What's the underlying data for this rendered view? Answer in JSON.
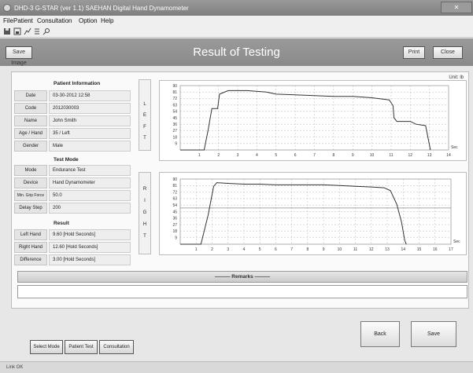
{
  "window": {
    "title": "DHD-3 G-STAR (ver 1.1) SAEHAN Digital Hand Dynamometer",
    "close_label": "✕"
  },
  "menu": [
    "File",
    "Patient",
    "Consultation",
    "Option",
    "Help"
  ],
  "toolbar": {
    "icons": [
      "disk-icon",
      "save-icon",
      "chart-icon",
      "list-icon",
      "search-icon"
    ]
  },
  "header": {
    "title": "Result of Testing",
    "save_image": "Save Image",
    "print": "Print",
    "close": "Close"
  },
  "unit": "Unit: lb",
  "patient": {
    "section": "Patient Information",
    "rows": [
      {
        "label": "Date",
        "value": "03-30-2012 12:58"
      },
      {
        "label": "Code",
        "value": "2012030003"
      },
      {
        "label": "Name",
        "value": "John Smith"
      },
      {
        "label": "Age / Hand",
        "value": "35 / Left"
      },
      {
        "label": "Gender",
        "value": "Male"
      }
    ]
  },
  "test_mode": {
    "section": "Test Mode",
    "rows": [
      {
        "label": "Mode",
        "value": "Endurance Test"
      },
      {
        "label": "Device",
        "value": "Hand Dynamometer"
      },
      {
        "label": "Min. Grip Force",
        "value": "50.0"
      },
      {
        "label": "Delay Step",
        "value": "200"
      }
    ]
  },
  "result": {
    "section": "Result",
    "rows": [
      {
        "label": "Left Hand",
        "value": "9.60 [Hold Seconds]"
      },
      {
        "label": "Right Hand",
        "value": "12.60 [Hold Seconds]"
      },
      {
        "label": "Difference",
        "value": "3.00 [Hold Seconds]"
      }
    ]
  },
  "side_labels": {
    "left": [
      "L",
      "E",
      "F",
      "T"
    ],
    "right": [
      "R",
      "I",
      "G",
      "H",
      "T"
    ]
  },
  "chart_data": [
    {
      "type": "line",
      "series": [
        {
          "name": "LEFT",
          "x": [
            0,
            1.25,
            1.45,
            1.65,
            1.95,
            2.05,
            2.5,
            3.5,
            4.5,
            5,
            6,
            7,
            8,
            9,
            10,
            10.9,
            11.1,
            11.15,
            11.3,
            12,
            12.3,
            12.8,
            13.05
          ],
          "y": [
            0,
            0,
            27,
            58,
            58,
            78,
            83,
            83,
            81,
            78,
            77,
            76,
            75,
            75,
            73,
            70,
            62,
            45,
            40,
            40,
            36,
            34,
            0
          ]
        }
      ],
      "xlabel": "Sec",
      "ylabel": "",
      "xlim": [
        0,
        14
      ],
      "ylim": [
        0,
        90
      ],
      "x_ticks": [
        1,
        2,
        3,
        4,
        5,
        6,
        7,
        8,
        9,
        10,
        11,
        12,
        13,
        14
      ],
      "y_ticks": [
        9,
        18,
        27,
        36,
        45,
        54,
        63,
        72,
        81,
        90
      ],
      "grid": true
    },
    {
      "type": "line",
      "series": [
        {
          "name": "RIGHT",
          "x": [
            0,
            1.3,
            1.5,
            1.75,
            2.1,
            2.3,
            3,
            4,
            5,
            6,
            7,
            8,
            9,
            10,
            11,
            12,
            12.8,
            13.2,
            13.6,
            13.9,
            14.1,
            14.2
          ],
          "y": [
            0,
            0,
            18,
            40,
            80,
            85,
            84,
            83,
            83,
            82,
            82,
            82,
            82,
            81,
            80,
            79,
            78,
            74,
            55,
            30,
            5,
            0
          ]
        }
      ],
      "xlabel": "Sec",
      "ylabel": "",
      "xlim": [
        0,
        17
      ],
      "ylim": [
        0,
        90
      ],
      "x_ticks": [
        1,
        2,
        3,
        4,
        5,
        6,
        7,
        8,
        9,
        10,
        11,
        12,
        13,
        14,
        15,
        16,
        17
      ],
      "y_ticks": [
        9,
        18,
        27,
        36,
        45,
        54,
        63,
        72,
        81,
        90
      ],
      "threshold": 50,
      "grid": true
    }
  ],
  "remarks": "Remarks",
  "buttons": {
    "back": "Back",
    "save": "Save",
    "select_mode": "Select Mode",
    "patient_test": "Patient Test",
    "consultation": "Consultation"
  },
  "status": "Link OK",
  "colors": {
    "curve": "#333333",
    "threshold": "#888888",
    "grid": "#b8b8b8"
  }
}
